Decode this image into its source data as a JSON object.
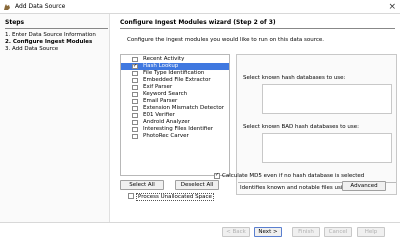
{
  "window": {
    "title": "Add Data Source",
    "app_icon": "autopsy-dog-icon",
    "close_icon": "close-icon"
  },
  "steps": {
    "header": "Steps",
    "items": [
      {
        "label": "1.   Enter Data Source Information",
        "current": false
      },
      {
        "label": "2.   Configure Ingest Modules",
        "current": true
      },
      {
        "label": "3.   Add Data Source",
        "current": false
      }
    ]
  },
  "wizard": {
    "title": "Configure Ingest Modules wizard (Step 2 of 3)",
    "description": "Configure the ingest modules you would like to run on this data source."
  },
  "modules": [
    {
      "label": "Recent Activity",
      "checked": false,
      "selected": false
    },
    {
      "label": "Hash Lookup",
      "checked": true,
      "selected": true
    },
    {
      "label": "File Type Identification",
      "checked": false,
      "selected": false
    },
    {
      "label": "Embedded File Extractor",
      "checked": false,
      "selected": false
    },
    {
      "label": "Exif Parser",
      "checked": false,
      "selected": false
    },
    {
      "label": "Keyword Search",
      "checked": false,
      "selected": false
    },
    {
      "label": "Email Parser",
      "checked": false,
      "selected": false
    },
    {
      "label": "Extension Mismatch Detector",
      "checked": false,
      "selected": false
    },
    {
      "label": "E01 Verifier",
      "checked": false,
      "selected": false
    },
    {
      "label": "Android Analyzer",
      "checked": false,
      "selected": false
    },
    {
      "label": "Interesting Files Identifier",
      "checked": false,
      "selected": false
    },
    {
      "label": "PhotoRec Carver",
      "checked": false,
      "selected": false
    }
  ],
  "list_buttons": {
    "select_all": "Select All",
    "deselect_all": "Deselect All"
  },
  "process_unallocated": {
    "label": "Process Unallocated Space",
    "checked": false
  },
  "settings": {
    "known_label": "Select known hash databases to use:",
    "bad_label": "Select known BAD hash databases to use:",
    "calc_md5_label": "Calculate MD5 even if no hash database is selected",
    "calc_md5_checked": true,
    "identifies_label": "Identifies known and notable files using ...",
    "advanced_button": "Advanced"
  },
  "footer": {
    "back": "< Back",
    "next": "Next >",
    "finish": "Finish",
    "cancel": "Cancel",
    "help": "Help"
  },
  "colors": {
    "selection": "#3f78e0",
    "disabled_text": "#b0b0b0"
  }
}
